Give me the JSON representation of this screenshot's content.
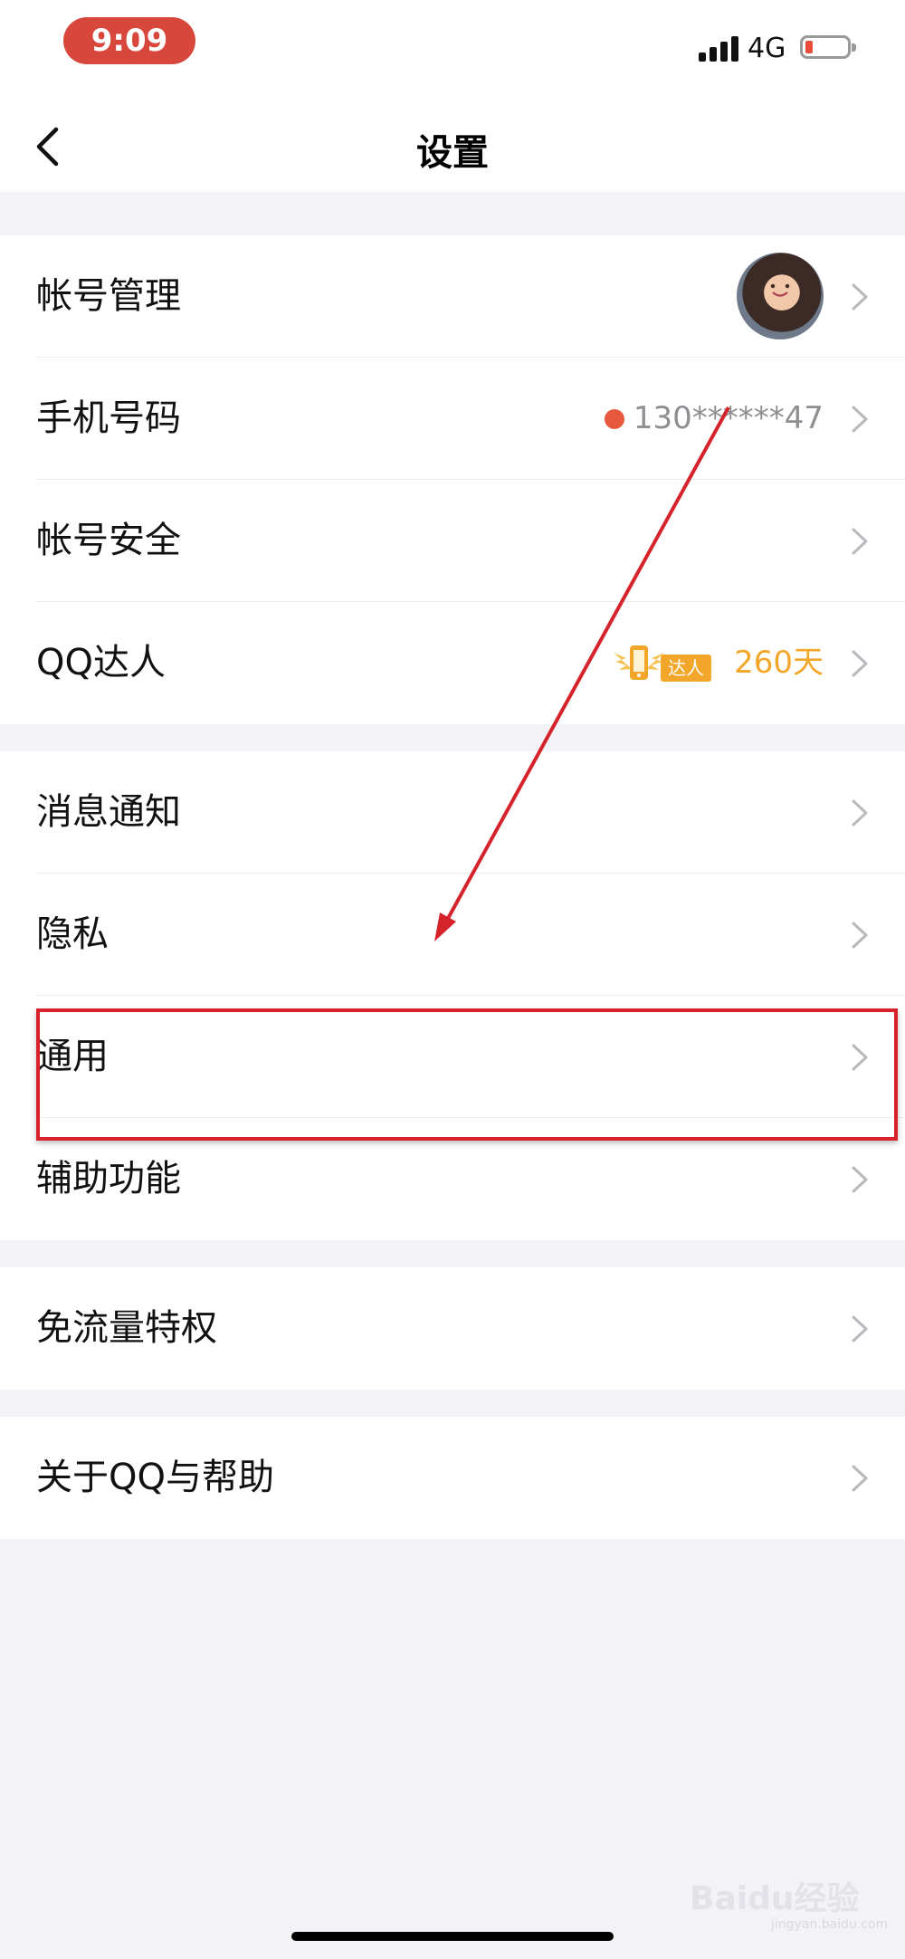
{
  "status_bar": {
    "time": "9:09",
    "network": "4G",
    "time_pill_color": "#d8473b",
    "battery_level": 0.15
  },
  "nav": {
    "title": "设置",
    "back_icon": "chevron-left-icon"
  },
  "groups": [
    {
      "rows": [
        {
          "label": "帐号管理",
          "accessory": "avatar"
        },
        {
          "label": "手机号码",
          "value": "130******47",
          "indicator_color": "#e8583f"
        },
        {
          "label": "帐号安全"
        },
        {
          "label": "QQ达人",
          "badge_text": "达人",
          "days": "260天",
          "badge_color": "#f3a72a"
        }
      ]
    },
    {
      "rows": [
        {
          "label": "消息通知"
        },
        {
          "label": "隐私"
        },
        {
          "label": "通用",
          "highlighted": true
        },
        {
          "label": "辅助功能"
        }
      ]
    },
    {
      "rows": [
        {
          "label": "免流量特权"
        }
      ]
    },
    {
      "rows": [
        {
          "label": "关于QQ与帮助"
        }
      ]
    }
  ],
  "annotation": {
    "color": "#d6232b",
    "arrow_target": "隐私",
    "box_target": "通用"
  },
  "watermark": {
    "brand": "Baidu经验",
    "url": "jingyan.baidu.com"
  }
}
